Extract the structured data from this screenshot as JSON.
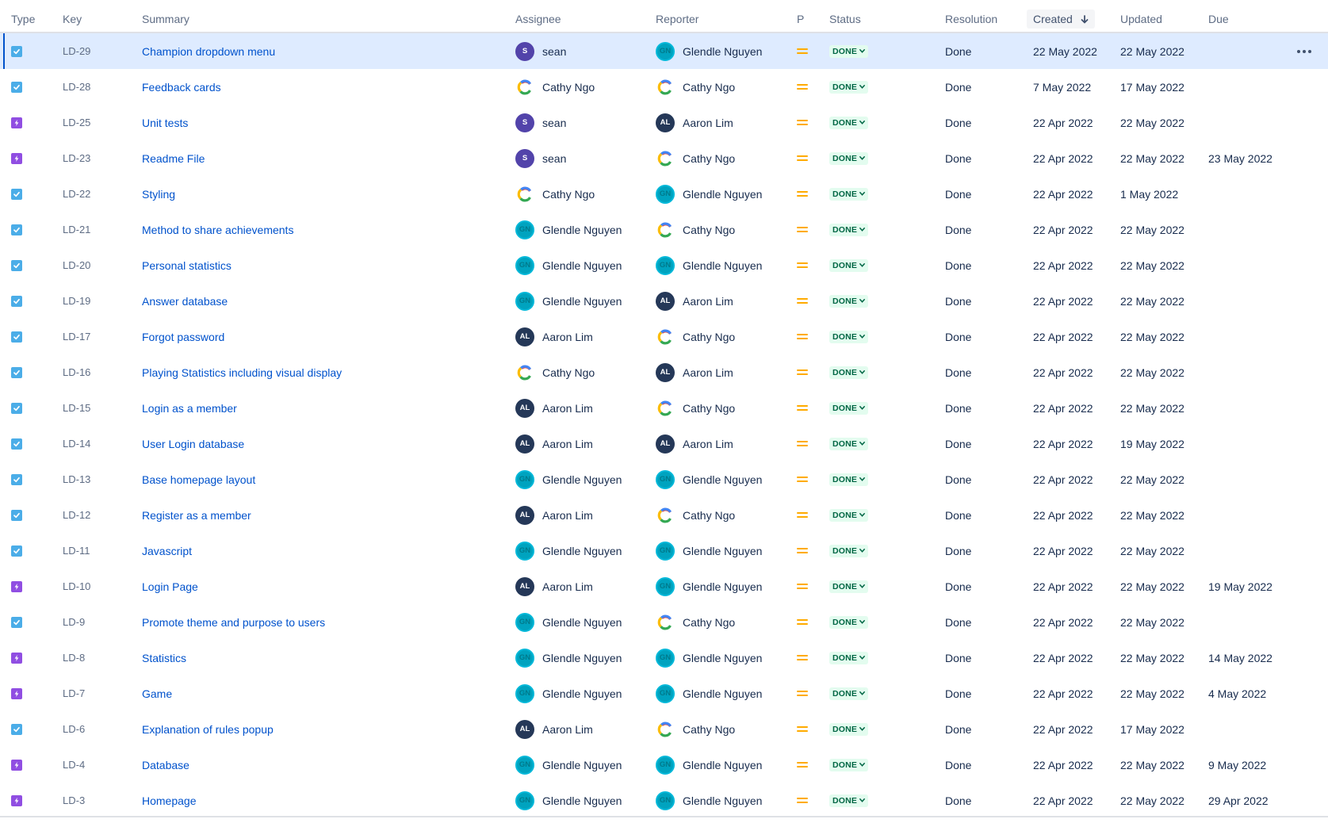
{
  "header": {
    "type": "Type",
    "key": "Key",
    "summary": "Summary",
    "assignee": "Assignee",
    "reporter": "Reporter",
    "priority": "P",
    "status": "Status",
    "resolution": "Resolution",
    "created": "Created",
    "updated": "Updated",
    "due": "Due",
    "sort_icon": "arrow-down-icon"
  },
  "colors": {
    "link": "#0052cc",
    "selected_row": "#deebff",
    "task_icon": "#4bade8",
    "epic_icon": "#904ee2",
    "status_bg": "#e3fcef",
    "status_text": "#006644",
    "priority_medium": "#ffab00"
  },
  "people": {
    "sean": {
      "initials": "S",
      "avatar": "purple"
    },
    "cathy": {
      "initials": "",
      "avatar": "google"
    },
    "glendle": {
      "initials": "GN",
      "avatar": "teal"
    },
    "aaron": {
      "initials": "AL",
      "avatar": "navy"
    }
  },
  "issues": [
    {
      "type": "task",
      "key": "LD-29",
      "summary": "Champion dropdown menu",
      "assignee": "sean",
      "assignee_id": "sean",
      "reporter": "Glendle Nguyen",
      "reporter_id": "glendle",
      "status": "DONE",
      "resolution": "Done",
      "created": "22 May 2022",
      "updated": "22 May 2022",
      "due": "",
      "selected": true
    },
    {
      "type": "task",
      "key": "LD-28",
      "summary": "Feedback cards",
      "assignee": "Cathy Ngo",
      "assignee_id": "cathy",
      "reporter": "Cathy Ngo",
      "reporter_id": "cathy",
      "status": "DONE",
      "resolution": "Done",
      "created": "7 May 2022",
      "updated": "17 May 2022",
      "due": ""
    },
    {
      "type": "epic",
      "key": "LD-25",
      "summary": "Unit tests",
      "assignee": "sean",
      "assignee_id": "sean",
      "reporter": "Aaron Lim",
      "reporter_id": "aaron",
      "status": "DONE",
      "resolution": "Done",
      "created": "22 Apr 2022",
      "updated": "22 May 2022",
      "due": ""
    },
    {
      "type": "epic",
      "key": "LD-23",
      "summary": "Readme File",
      "assignee": "sean",
      "assignee_id": "sean",
      "reporter": "Cathy Ngo",
      "reporter_id": "cathy",
      "status": "DONE",
      "resolution": "Done",
      "created": "22 Apr 2022",
      "updated": "22 May 2022",
      "due": "23 May 2022"
    },
    {
      "type": "task",
      "key": "LD-22",
      "summary": "Styling",
      "assignee": "Cathy Ngo",
      "assignee_id": "cathy",
      "reporter": "Glendle Nguyen",
      "reporter_id": "glendle",
      "status": "DONE",
      "resolution": "Done",
      "created": "22 Apr 2022",
      "updated": "1 May 2022",
      "due": ""
    },
    {
      "type": "task",
      "key": "LD-21",
      "summary": "Method to share achievements",
      "assignee": "Glendle Nguyen",
      "assignee_id": "glendle",
      "reporter": "Cathy Ngo",
      "reporter_id": "cathy",
      "status": "DONE",
      "resolution": "Done",
      "created": "22 Apr 2022",
      "updated": "22 May 2022",
      "due": ""
    },
    {
      "type": "task",
      "key": "LD-20",
      "summary": "Personal statistics",
      "assignee": "Glendle Nguyen",
      "assignee_id": "glendle",
      "reporter": "Glendle Nguyen",
      "reporter_id": "glendle",
      "status": "DONE",
      "resolution": "Done",
      "created": "22 Apr 2022",
      "updated": "22 May 2022",
      "due": ""
    },
    {
      "type": "task",
      "key": "LD-19",
      "summary": "Answer database",
      "assignee": "Glendle Nguyen",
      "assignee_id": "glendle",
      "reporter": "Aaron Lim",
      "reporter_id": "aaron",
      "status": "DONE",
      "resolution": "Done",
      "created": "22 Apr 2022",
      "updated": "22 May 2022",
      "due": ""
    },
    {
      "type": "task",
      "key": "LD-17",
      "summary": "Forgot password",
      "assignee": "Aaron Lim",
      "assignee_id": "aaron",
      "reporter": "Cathy Ngo",
      "reporter_id": "cathy",
      "status": "DONE",
      "resolution": "Done",
      "created": "22 Apr 2022",
      "updated": "22 May 2022",
      "due": ""
    },
    {
      "type": "task",
      "key": "LD-16",
      "summary": "Playing Statistics including visual display",
      "assignee": "Cathy Ngo",
      "assignee_id": "cathy",
      "reporter": "Aaron Lim",
      "reporter_id": "aaron",
      "status": "DONE",
      "resolution": "Done",
      "created": "22 Apr 2022",
      "updated": "22 May 2022",
      "due": ""
    },
    {
      "type": "task",
      "key": "LD-15",
      "summary": "Login as a member",
      "assignee": "Aaron Lim",
      "assignee_id": "aaron",
      "reporter": "Cathy Ngo",
      "reporter_id": "cathy",
      "status": "DONE",
      "resolution": "Done",
      "created": "22 Apr 2022",
      "updated": "22 May 2022",
      "due": ""
    },
    {
      "type": "task",
      "key": "LD-14",
      "summary": "User Login database",
      "assignee": "Aaron Lim",
      "assignee_id": "aaron",
      "reporter": "Aaron Lim",
      "reporter_id": "aaron",
      "status": "DONE",
      "resolution": "Done",
      "created": "22 Apr 2022",
      "updated": "19 May 2022",
      "due": ""
    },
    {
      "type": "task",
      "key": "LD-13",
      "summary": "Base homepage layout",
      "assignee": "Glendle Nguyen",
      "assignee_id": "glendle",
      "reporter": "Glendle Nguyen",
      "reporter_id": "glendle",
      "status": "DONE",
      "resolution": "Done",
      "created": "22 Apr 2022",
      "updated": "22 May 2022",
      "due": ""
    },
    {
      "type": "task",
      "key": "LD-12",
      "summary": "Register as a member",
      "assignee": "Aaron Lim",
      "assignee_id": "aaron",
      "reporter": "Cathy Ngo",
      "reporter_id": "cathy",
      "status": "DONE",
      "resolution": "Done",
      "created": "22 Apr 2022",
      "updated": "22 May 2022",
      "due": ""
    },
    {
      "type": "task",
      "key": "LD-11",
      "summary": "Javascript",
      "assignee": "Glendle Nguyen",
      "assignee_id": "glendle",
      "reporter": "Glendle Nguyen",
      "reporter_id": "glendle",
      "status": "DONE",
      "resolution": "Done",
      "created": "22 Apr 2022",
      "updated": "22 May 2022",
      "due": ""
    },
    {
      "type": "epic",
      "key": "LD-10",
      "summary": "Login Page",
      "assignee": "Aaron Lim",
      "assignee_id": "aaron",
      "reporter": "Glendle Nguyen",
      "reporter_id": "glendle",
      "status": "DONE",
      "resolution": "Done",
      "created": "22 Apr 2022",
      "updated": "22 May 2022",
      "due": "19 May 2022"
    },
    {
      "type": "task",
      "key": "LD-9",
      "summary": "Promote theme and purpose to users",
      "assignee": "Glendle Nguyen",
      "assignee_id": "glendle",
      "reporter": "Cathy Ngo",
      "reporter_id": "cathy",
      "status": "DONE",
      "resolution": "Done",
      "created": "22 Apr 2022",
      "updated": "22 May 2022",
      "due": ""
    },
    {
      "type": "epic",
      "key": "LD-8",
      "summary": "Statistics",
      "assignee": "Glendle Nguyen",
      "assignee_id": "glendle",
      "reporter": "Glendle Nguyen",
      "reporter_id": "glendle",
      "status": "DONE",
      "resolution": "Done",
      "created": "22 Apr 2022",
      "updated": "22 May 2022",
      "due": "14 May 2022"
    },
    {
      "type": "epic",
      "key": "LD-7",
      "summary": "Game",
      "assignee": "Glendle Nguyen",
      "assignee_id": "glendle",
      "reporter": "Glendle Nguyen",
      "reporter_id": "glendle",
      "status": "DONE",
      "resolution": "Done",
      "created": "22 Apr 2022",
      "updated": "22 May 2022",
      "due": "4 May 2022"
    },
    {
      "type": "task",
      "key": "LD-6",
      "summary": "Explanation of rules popup",
      "assignee": "Aaron Lim",
      "assignee_id": "aaron",
      "reporter": "Cathy Ngo",
      "reporter_id": "cathy",
      "status": "DONE",
      "resolution": "Done",
      "created": "22 Apr 2022",
      "updated": "17 May 2022",
      "due": ""
    },
    {
      "type": "epic",
      "key": "LD-4",
      "summary": "Database",
      "assignee": "Glendle Nguyen",
      "assignee_id": "glendle",
      "reporter": "Glendle Nguyen",
      "reporter_id": "glendle",
      "status": "DONE",
      "resolution": "Done",
      "created": "22 Apr 2022",
      "updated": "22 May 2022",
      "due": "9 May 2022"
    },
    {
      "type": "epic",
      "key": "LD-3",
      "summary": "Homepage",
      "assignee": "Glendle Nguyen",
      "assignee_id": "glendle",
      "reporter": "Glendle Nguyen",
      "reporter_id": "glendle",
      "status": "DONE",
      "resolution": "Done",
      "created": "22 Apr 2022",
      "updated": "22 May 2022",
      "due": "29 Apr 2022"
    }
  ]
}
